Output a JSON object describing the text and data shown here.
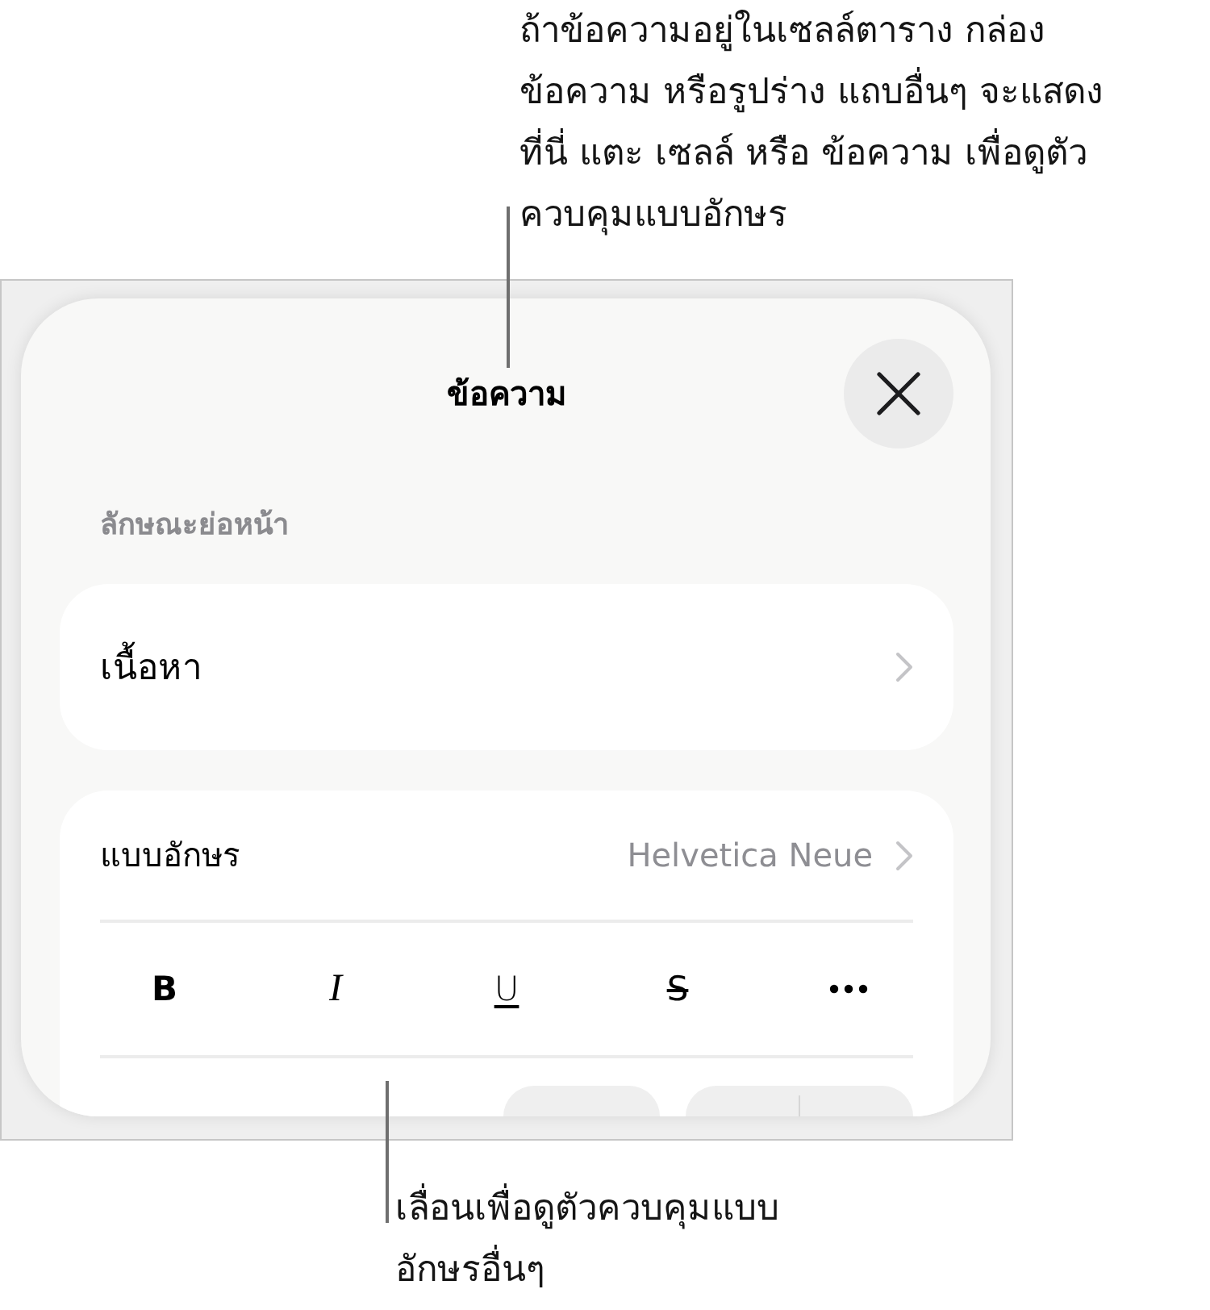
{
  "top_callout": {
    "lines": [
      "ถ้าข้อความอยู่ในเซลล์ตาราง กล่อง",
      "ข้อความ หรือรูปร่าง แถบอื่นๆ จะแสดง",
      "ที่นี่ แตะ เซลล์ หรือ ข้อความ เพื่อดูตัว",
      "ควบคุมแบบอักษร"
    ]
  },
  "sheet": {
    "title": "ข้อความ",
    "section_label": "ลักษณะย่อหน้า",
    "paragraph_style": {
      "label": "เนื้อหา"
    },
    "font": {
      "label": "แบบอักษร",
      "value": "Helvetica Neue"
    },
    "style_buttons": [
      {
        "kind": "bold",
        "label": "B"
      },
      {
        "kind": "italic",
        "label": "I"
      },
      {
        "kind": "underline",
        "label": "U"
      },
      {
        "kind": "strikethrough",
        "label": "S"
      },
      {
        "kind": "more"
      }
    ]
  },
  "bottom_callout": {
    "lines": [
      "เลื่อนเพื่อดูตัวควบคุมแบบ",
      "อักษรอื่นๆ"
    ]
  }
}
